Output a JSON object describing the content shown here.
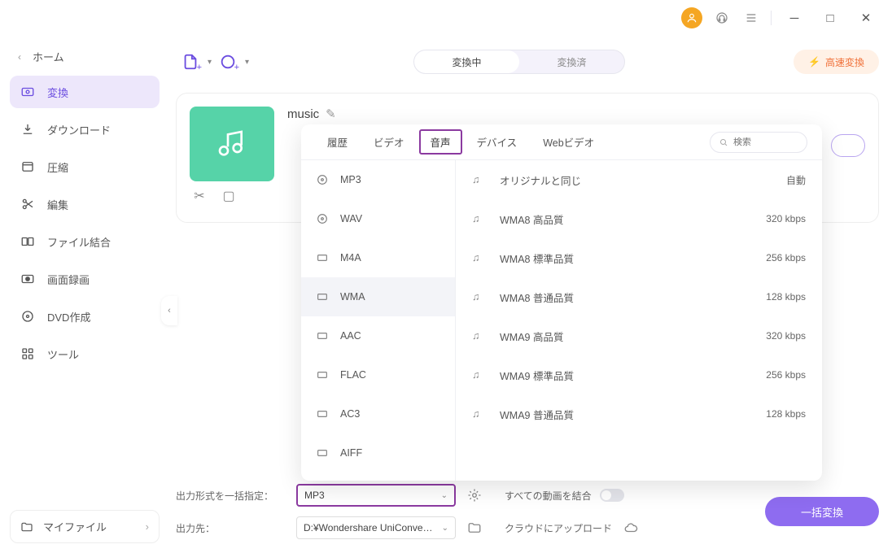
{
  "titlebar": {
    "minimize": "—",
    "maximize": "▢",
    "close": "✕"
  },
  "sidebar": {
    "home": "ホーム",
    "items": [
      {
        "label": "変換"
      },
      {
        "label": "ダウンロード"
      },
      {
        "label": "圧縮"
      },
      {
        "label": "編集"
      },
      {
        "label": "ファイル結合"
      },
      {
        "label": "画面録画"
      },
      {
        "label": "DVD作成"
      },
      {
        "label": "ツール"
      }
    ],
    "myfile": "マイファイル"
  },
  "topbar": {
    "tab_active": "変換中",
    "tab_done": "変換済",
    "fast": "高速変換"
  },
  "card": {
    "name": "music"
  },
  "panel": {
    "tabs": {
      "history": "履歴",
      "video": "ビデオ",
      "audio": "音声",
      "device": "デバイス",
      "web": "Webビデオ"
    },
    "search_placeholder": "検索",
    "formats": [
      "MP3",
      "WAV",
      "M4A",
      "WMA",
      "AAC",
      "FLAC",
      "AC3",
      "AIFF"
    ],
    "qualities": [
      {
        "label": "オリジナルと同じ",
        "rate": "自動"
      },
      {
        "label": "WMA8 高品質",
        "rate": "320 kbps"
      },
      {
        "label": "WMA8 標準品質",
        "rate": "256 kbps"
      },
      {
        "label": "WMA8 普通品質",
        "rate": "128 kbps"
      },
      {
        "label": "WMA9 高品質",
        "rate": "320 kbps"
      },
      {
        "label": "WMA9 標準品質",
        "rate": "256 kbps"
      },
      {
        "label": "WMA9 普通品質",
        "rate": "128 kbps"
      }
    ]
  },
  "bottom": {
    "format_label": "出力形式を一括指定：",
    "format_value": "MP3",
    "folder_label": "出力先：",
    "folder_value": "D:¥Wondershare UniConverter",
    "merge": "すべての動画を結合",
    "cloud": "クラウドにアップロード",
    "convert": "一括変換"
  }
}
